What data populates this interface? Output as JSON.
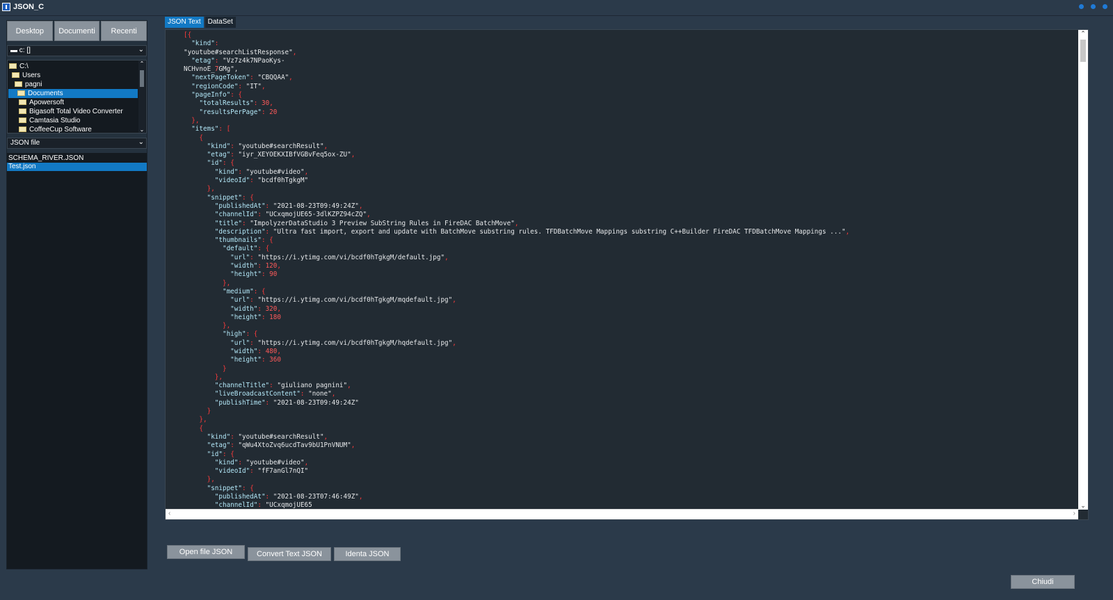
{
  "window": {
    "title": "JSON_C"
  },
  "sidebar": {
    "nav": [
      "Desktop",
      "Documenti",
      "Recenti"
    ],
    "drive": "c: []",
    "tree": [
      "C:\\",
      "Users",
      "pagni",
      "Documents",
      "Apowersoft",
      "Bigasoft Total Video Converter",
      "Camtasia Studio",
      "CoffeeCup Software"
    ],
    "filter": "JSON file",
    "files": [
      "SCHEMA_RIVER.JSON",
      "Test.json"
    ]
  },
  "tabs": [
    "JSON Text",
    "DataSet"
  ],
  "editor": {
    "lines": [
      "[{",
      "  \"kind\":",
      "\"youtube#searchListResponse\",",
      "  \"etag\": \"Vz7z4k7NPaoKys-",
      "NCHvnoE_7GMg\",",
      "  \"nextPageToken\": \"CBQQAA\",",
      "  \"regionCode\": \"IT\",",
      "  \"pageInfo\": {",
      "    \"totalResults\": 30,",
      "    \"resultsPerPage\": 20",
      "  },",
      "  \"items\": [",
      "    {",
      "      \"kind\": \"youtube#searchResult\",",
      "      \"etag\": \"iyr_XEYOEKXIBfVGBvFeq5ox-ZU\",",
      "      \"id\": {",
      "        \"kind\": \"youtube#video\",",
      "        \"videoId\": \"bcdf0hTgkgM\"",
      "      },",
      "      \"snippet\": {",
      "        \"publishedAt\": \"2021-08-23T09:49:24Z\",",
      "        \"channelId\": \"UCxqmojUE65-3dlKZPZ94cZQ\",",
      "        \"title\": \"ImpolyzerDataStudio 3 Preview SubString Rules in FireDAC BatchMove\",",
      "        \"description\": \"Ultra fast import, export and update with BatchMove substring rules. TFDBatchMove Mappings substring C++Builder FireDAC TFDBatchMove Mappings ...\",",
      "        \"thumbnails\": {",
      "          \"default\": {",
      "            \"url\": \"https://i.ytimg.com/vi/bcdf0hTgkgM/default.jpg\",",
      "            \"width\": 120,",
      "            \"height\": 90",
      "          },",
      "          \"medium\": {",
      "            \"url\": \"https://i.ytimg.com/vi/bcdf0hTgkgM/mqdefault.jpg\",",
      "            \"width\": 320,",
      "            \"height\": 180",
      "          },",
      "          \"high\": {",
      "            \"url\": \"https://i.ytimg.com/vi/bcdf0hTgkgM/hqdefault.jpg\",",
      "            \"width\": 480,",
      "            \"height\": 360",
      "          }",
      "        },",
      "        \"channelTitle\": \"giuliano pagnini\",",
      "        \"liveBroadcastContent\": \"none\",",
      "        \"publishTime\": \"2021-08-23T09:49:24Z\"",
      "      }",
      "    },",
      "    {",
      "      \"kind\": \"youtube#searchResult\",",
      "      \"etag\": \"qWu4XtoZvq6ucdTav9bU1PnVNUM\",",
      "      \"id\": {",
      "        \"kind\": \"youtube#video\",",
      "        \"videoId\": \"fF7anGl7nQI\"",
      "      },",
      "      \"snippet\": {",
      "        \"publishedAt\": \"2021-08-23T07:46:49Z\",",
      "        \"channelId\": \"UCxqmojUE65"
    ]
  },
  "buttons": {
    "open": "Open file JSON",
    "convert": "Convert Text JSON",
    "indent": "Identa JSON",
    "close": "Chiudi"
  },
  "colors": {
    "accent": "#1279c4",
    "json_key": "#b3e8f8",
    "json_number": "#ff5a5a",
    "json_punct": "#ff3b3b"
  }
}
